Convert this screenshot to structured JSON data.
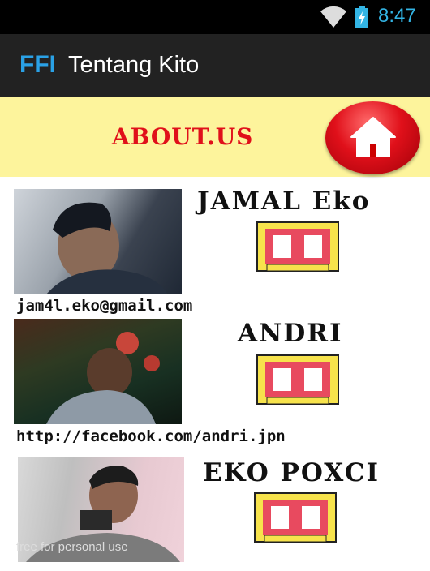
{
  "status_bar": {
    "time": "8:47"
  },
  "action_bar": {
    "logo": "FFI",
    "title": "Tentang Kito"
  },
  "banner": {
    "heading": "ABOUT.US"
  },
  "members": [
    {
      "name": "JAMAL Eko",
      "contact": "jam4l.eko@gmail.com"
    },
    {
      "name": "ANDRI",
      "contact": "http://facebook.com/andri.jpn"
    },
    {
      "name": "EKO POXCI",
      "contact": ""
    }
  ],
  "watermark": "free for personal use",
  "colors": {
    "accent": "#33b5e5",
    "banner_bg": "#fdf49c",
    "heading_red": "#e0101a"
  }
}
